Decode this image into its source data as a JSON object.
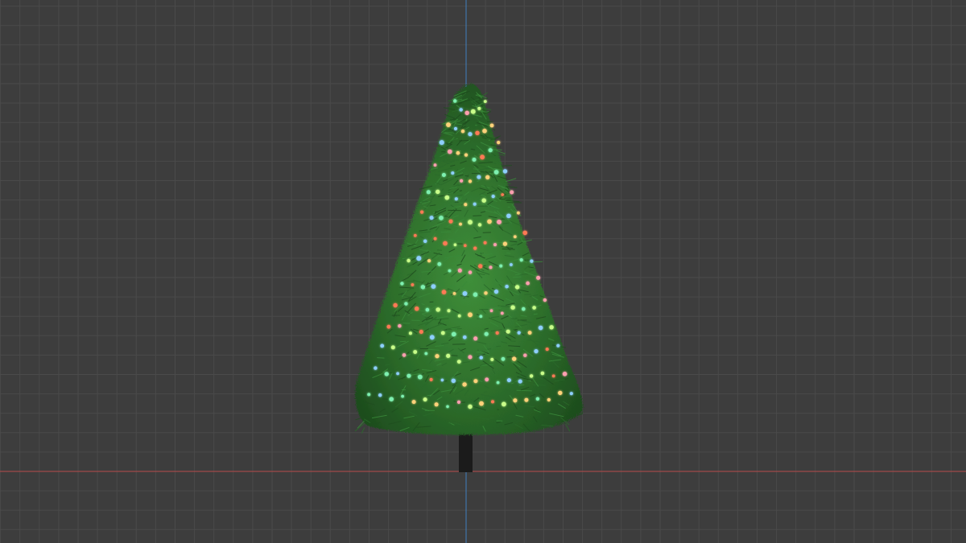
{
  "viewport": {
    "background_color": "#3d3d3d",
    "grid_color": "#4a4a4a",
    "x_axis_color": "#b84a4a",
    "y_axis_color": "#3f7fbf"
  },
  "scene_object": {
    "name": "christmas-tree",
    "foliage_colors": [
      "#1e4d1e",
      "#2a6a2a",
      "#3a8a3a"
    ],
    "trunk_color": "#1b1b1b",
    "light_colors": [
      "#ff7a55",
      "#ffd27a",
      "#7ef0b0",
      "#8ecfff",
      "#ff9fb0",
      "#c9ff8a"
    ]
  }
}
